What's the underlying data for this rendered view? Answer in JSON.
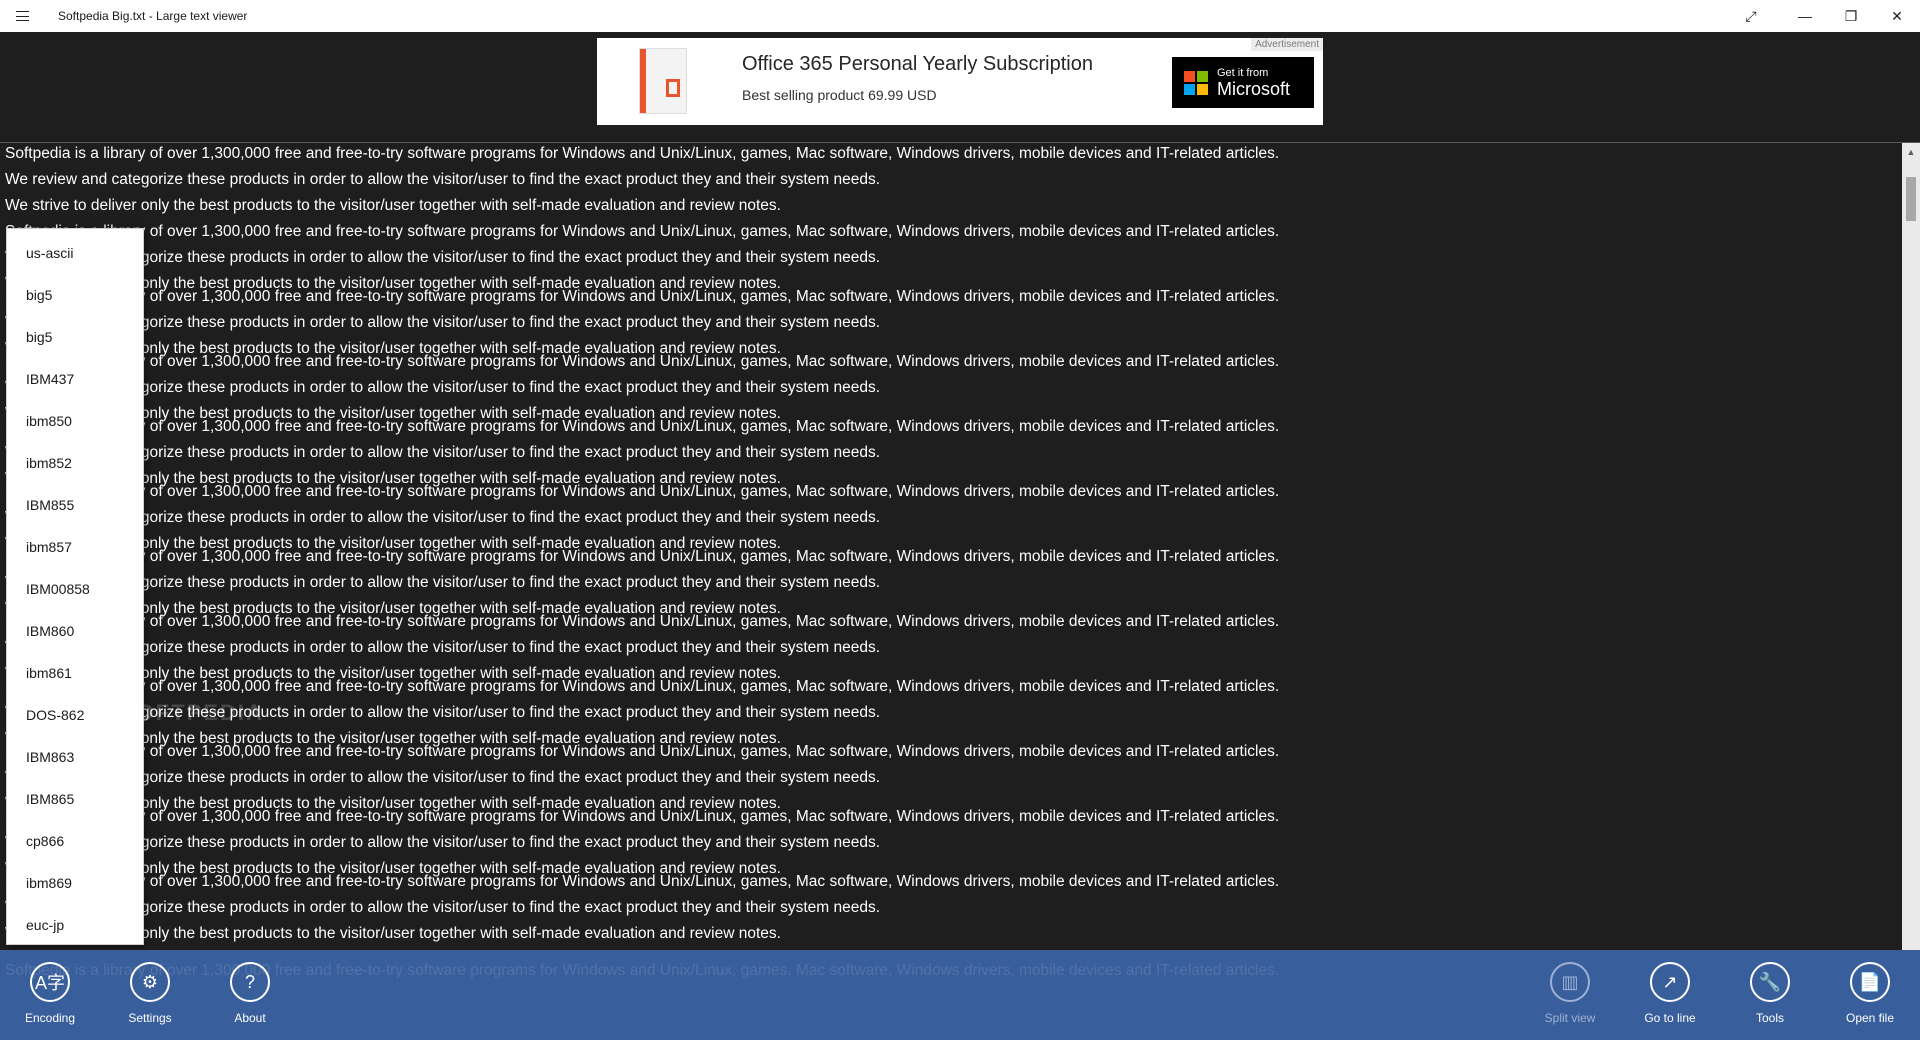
{
  "window": {
    "title": "Softpedia Big.txt - Large text viewer",
    "menu_icon": "hamburger-menu-icon",
    "controls": [
      "fullscreen-icon",
      "minimize-icon",
      "restore-icon",
      "close-icon"
    ]
  },
  "ad": {
    "tag": "Advertisement",
    "title": "Office 365 Personal Yearly Subscription",
    "subtitle": "Best selling product  69.99 USD",
    "store_small": "Get it from",
    "store_big": "Microsoft",
    "logo_colors": [
      "#f25022",
      "#7fba00",
      "#00a4ef",
      "#ffb900"
    ]
  },
  "document": {
    "lines": [
      "Softpedia is a library of over 1,300,000 free and free-to-try software programs for Windows and Unix/Linux, games, Mac software, Windows drivers, mobile devices and IT-related articles.",
      "We review and categorize these products in order to allow the visitor/user to find the exact product they and their system needs.",
      "We strive to deliver only the best products to the visitor/user together with self-made evaluation and review notes."
    ]
  },
  "encoding_menu": {
    "items": [
      "us-ascii",
      "big5",
      "big5",
      "IBM437",
      "ibm850",
      "ibm852",
      "IBM855",
      "ibm857",
      "IBM00858",
      "IBM860",
      "ibm861",
      "DOS-862",
      "IBM863",
      "IBM865",
      "cp866",
      "ibm869",
      "euc-jp"
    ]
  },
  "watermark": "SOFTPEDIA",
  "commands": {
    "left": [
      {
        "label": "Encoding",
        "icon": "encoding-icon"
      },
      {
        "label": "Settings",
        "icon": "gear-icon"
      },
      {
        "label": "About",
        "icon": "question-icon"
      }
    ],
    "right": [
      {
        "label": "Split view",
        "icon": "split-view-icon",
        "disabled": true
      },
      {
        "label": "Go to line",
        "icon": "arrow-up-right-icon",
        "disabled": false
      },
      {
        "label": "Tools",
        "icon": "wrench-icon",
        "disabled": false
      },
      {
        "label": "Open file",
        "icon": "open-file-icon",
        "disabled": false
      }
    ]
  },
  "colors": {
    "background": "#1e1e1e",
    "command_bar": "#3a60a0",
    "text": "#ffffff"
  }
}
